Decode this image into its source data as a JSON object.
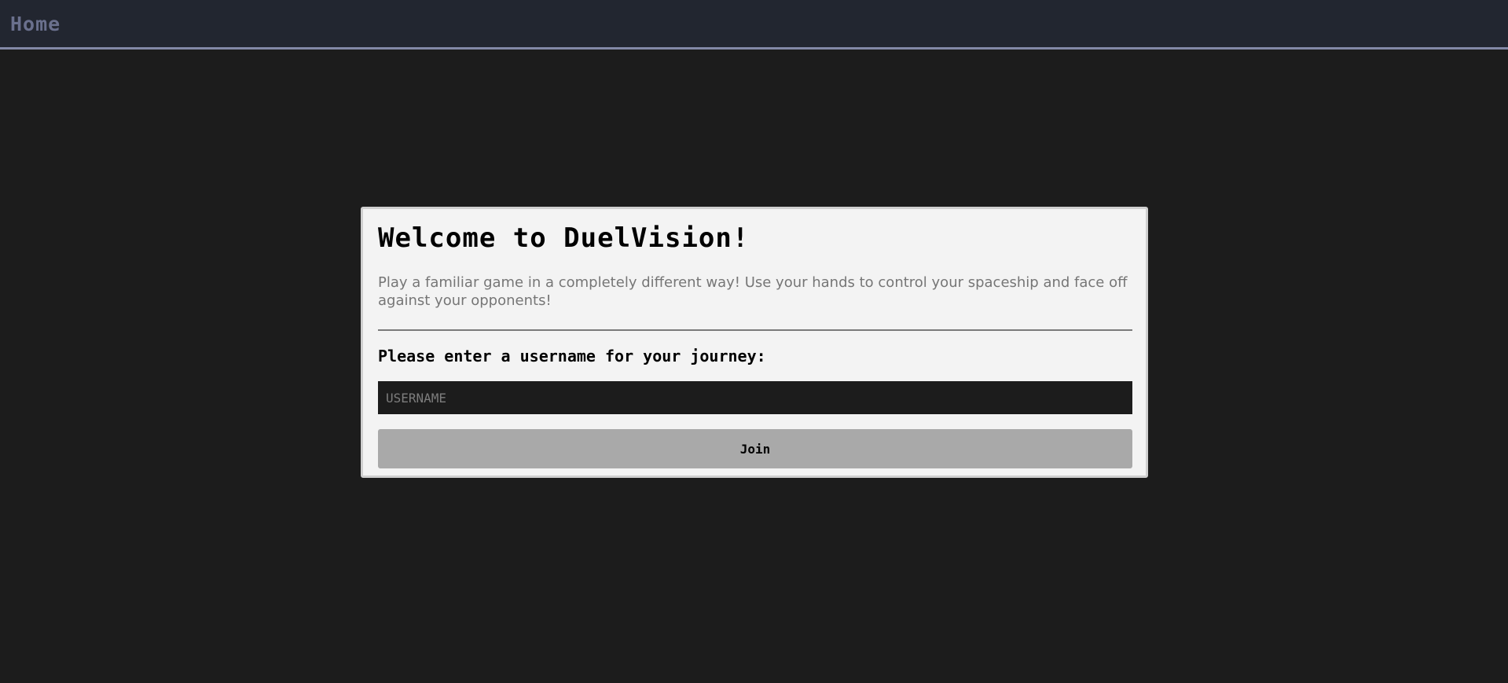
{
  "nav": {
    "home_label": "Home"
  },
  "card": {
    "title": "Welcome to DuelVision!",
    "description": "Play a familiar game in a completely different way! Use your hands to control your spaceship and face off against your opponents!",
    "prompt": "Please enter a username for your journey:",
    "username_placeholder": "USERNAME",
    "username_value": "",
    "join_label": "Join"
  },
  "colors": {
    "page_background": "#1c1c1c",
    "topbar_background": "#222630",
    "topbar_border": "#8288a6",
    "home_text": "#6a708d",
    "card_background": "#f3f3f3",
    "input_background": "#1c1c1c",
    "button_background": "#a9a9a9"
  }
}
